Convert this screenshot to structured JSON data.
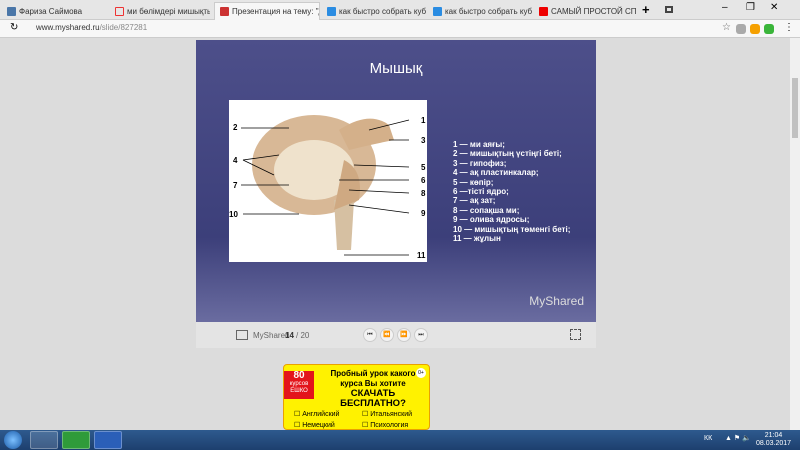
{
  "browser": {
    "tabs": [
      {
        "label": "Фариза Саймова",
        "color": "#4a76a8"
      },
      {
        "label": "ми бөлімдері мишықтың қызм",
        "color": "#e33"
      },
      {
        "label": "Презентация на тему: \"Дәріс",
        "color": "#c33"
      },
      {
        "label": "как быстро собрать кубик руб",
        "color": "#2a8ce2"
      },
      {
        "label": "как быстро собрать кубик руб",
        "color": "#2a8ce2"
      },
      {
        "label": "САМЫЙ ПРОСТОЙ СПОСОБ",
        "color": "#e00"
      }
    ],
    "url_host": "www.myshared.ru",
    "url_path": "/slide/827281"
  },
  "slide": {
    "title": "Мышық",
    "legend": [
      "1 — ми аяғы;",
      "2 — мишықтың үстіңгі беті;",
      "3 — гипофиз;",
      "4 — ақ пластинкалар;",
      "5 — көпір;",
      "6 —тісті ядро;",
      "7 — ақ зат;",
      "8 — сопақша ми;",
      "9 — олива ядросы;",
      "10 — мишықтың төменгі беті;",
      "11 — жұлын"
    ],
    "labels": [
      "1",
      "2",
      "3",
      "4",
      "5",
      "6",
      "7",
      "8",
      "9",
      "10",
      "11"
    ],
    "brand": "MyShared"
  },
  "controls": {
    "brand": "MyShared",
    "current": "14",
    "total": "/ 20"
  },
  "ad": {
    "badge_num": "80",
    "badge_text1": "курсов",
    "badge_text2": "ЕШКО",
    "age": "0+",
    "line1": "Пробный урок какого",
    "line2": "курса Вы хотите",
    "line3": "СКАЧАТЬ БЕСПЛАТНО?",
    "options": [
      "Английский",
      "Итальянский",
      "Немецкий",
      "Психология"
    ]
  },
  "taskbar": {
    "lang": "КК",
    "time": "21:04",
    "date": "08.03.2017"
  }
}
